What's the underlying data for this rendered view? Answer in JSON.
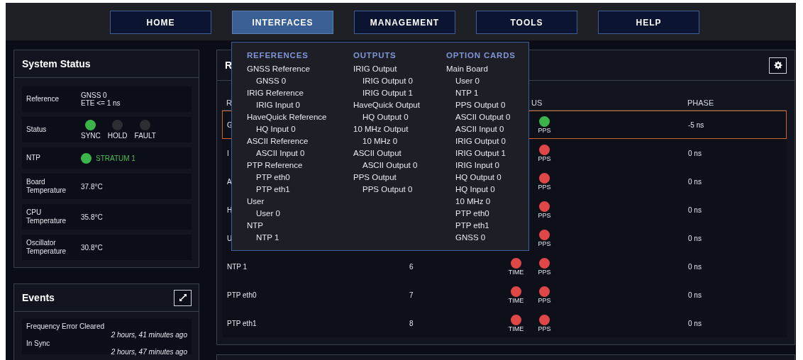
{
  "nav": [
    {
      "label": "HOME",
      "selected": false
    },
    {
      "label": "INTERFACES",
      "selected": true
    },
    {
      "label": "MANAGEMENT",
      "selected": false
    },
    {
      "label": "TOOLS",
      "selected": false
    },
    {
      "label": "HELP",
      "selected": false
    }
  ],
  "menu": [
    {
      "heading": "REFERENCES",
      "items": [
        {
          "label": "GNSS Reference",
          "children": [
            {
              "label": "GNSS 0"
            }
          ]
        },
        {
          "label": "IRIG Reference",
          "children": [
            {
              "label": "IRIG Input 0"
            }
          ]
        },
        {
          "label": "HaveQuick Reference",
          "children": [
            {
              "label": "HQ Input 0"
            }
          ]
        },
        {
          "label": "ASCII Reference",
          "children": [
            {
              "label": "ASCII Input 0"
            }
          ]
        },
        {
          "label": "PTP Reference",
          "children": [
            {
              "label": "PTP eth0"
            },
            {
              "label": "PTP eth1"
            }
          ]
        },
        {
          "label": "User",
          "children": [
            {
              "label": "User 0"
            }
          ]
        },
        {
          "label": "NTP",
          "children": [
            {
              "label": "NTP 1"
            }
          ]
        }
      ]
    },
    {
      "heading": "OUTPUTS",
      "items": [
        {
          "label": "IRIG Output",
          "children": [
            {
              "label": "IRIG Output 0"
            },
            {
              "label": "IRIG Output 1"
            }
          ]
        },
        {
          "label": "HaveQuick Output",
          "children": [
            {
              "label": "HQ Output 0"
            }
          ]
        },
        {
          "label": "10 MHz Output",
          "children": [
            {
              "label": "10 MHz 0"
            }
          ]
        },
        {
          "label": "ASCII Output",
          "children": [
            {
              "label": "ASCII Output 0"
            }
          ]
        },
        {
          "label": "PPS Output",
          "children": [
            {
              "label": "PPS Output 0"
            }
          ]
        }
      ]
    },
    {
      "heading": "OPTION CARDS",
      "items": [
        {
          "label": "Main Board",
          "children": [
            {
              "label": "User 0"
            },
            {
              "label": "NTP 1"
            },
            {
              "label": "PPS Output 0"
            },
            {
              "label": "ASCII Output 0"
            },
            {
              "label": "ASCII Input 0"
            },
            {
              "label": "IRIG Output 0"
            },
            {
              "label": "IRIG Output 1"
            },
            {
              "label": "IRIG Input 0"
            },
            {
              "label": "HQ Output 0"
            },
            {
              "label": "HQ Input 0"
            },
            {
              "label": "10 MHz 0"
            },
            {
              "label": "PTP eth0"
            },
            {
              "label": "PTP eth1"
            },
            {
              "label": "GNSS 0"
            }
          ]
        }
      ]
    }
  ],
  "system_status": {
    "title": "System Status",
    "rows": [
      {
        "kind": "text",
        "label": "Reference",
        "values": [
          "GNSS 0",
          "ETE <= 1 ns"
        ]
      },
      {
        "kind": "lamps",
        "label": "Status",
        "lamps": [
          {
            "label": "SYNC",
            "on": true
          },
          {
            "label": "HOLD",
            "on": false
          },
          {
            "label": "FAULT",
            "on": false
          }
        ]
      },
      {
        "kind": "ntp",
        "label": "NTP",
        "on": true,
        "value": "STRATUM 1"
      },
      {
        "kind": "text",
        "label": "Board Temperature",
        "values": [
          "37.8°C"
        ]
      },
      {
        "kind": "text",
        "label": "CPU Temperature",
        "values": [
          "35.8°C"
        ]
      },
      {
        "kind": "text",
        "label": "Oscillator Temperature",
        "values": [
          "30.8°C"
        ]
      }
    ]
  },
  "events": {
    "title": "Events",
    "items": [
      {
        "message": "Frequency Error Cleared",
        "time": "2 hours, 41 minutes ago"
      },
      {
        "message": "In Sync",
        "time": "2 hours, 47 minutes ago"
      }
    ]
  },
  "references": {
    "title": "R",
    "header": {
      "name": "R",
      "status": "US",
      "phase": "PHASE"
    },
    "rows": [
      {
        "name": "G",
        "selected": true,
        "signals": [
          {
            "label": "PPS",
            "ok": true
          }
        ],
        "phase": "-5 ns"
      },
      {
        "name": "I",
        "selected": false,
        "signals": [
          {
            "label": "PPS",
            "ok": false
          }
        ],
        "phase": "0 ns"
      },
      {
        "name": "A",
        "selected": false,
        "signals": [
          {
            "label": "PPS",
            "ok": false
          }
        ],
        "phase": "0 ns"
      },
      {
        "name": "H",
        "selected": false,
        "signals": [
          {
            "label": "PPS",
            "ok": false
          }
        ],
        "phase": "0 ns"
      },
      {
        "name": "U",
        "selected": false,
        "signals": [
          {
            "label": "PPS",
            "ok": false
          }
        ],
        "phase": "0 ns"
      },
      {
        "name": "NTP 1",
        "priority": "6",
        "selected": false,
        "signals": [
          {
            "label": "TIME",
            "ok": false
          },
          {
            "label": "PPS",
            "ok": false
          }
        ],
        "phase": "0 ns"
      },
      {
        "name": "PTP eth0",
        "priority": "7",
        "selected": false,
        "signals": [
          {
            "label": "TIME",
            "ok": false
          },
          {
            "label": "PPS",
            "ok": false
          }
        ],
        "phase": "0 ns"
      },
      {
        "name": "PTP eth1",
        "priority": "8",
        "selected": false,
        "signals": [
          {
            "label": "TIME",
            "ok": false
          },
          {
            "label": "PPS",
            "ok": false
          }
        ],
        "phase": "0 ns"
      }
    ]
  }
}
